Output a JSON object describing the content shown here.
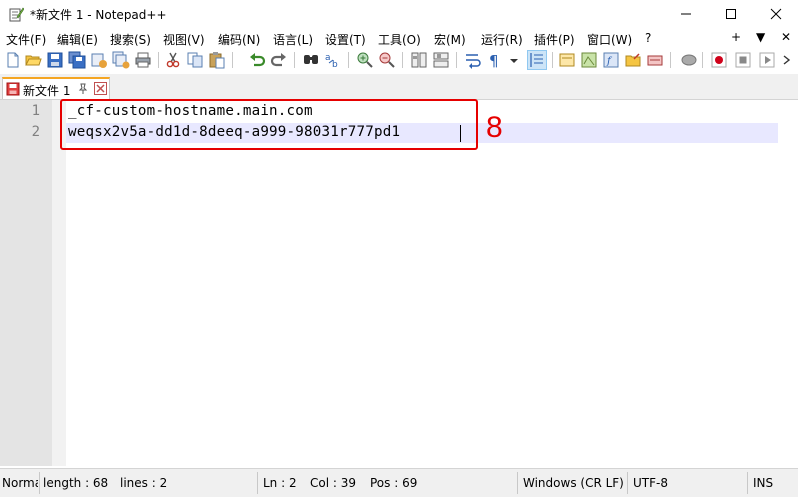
{
  "window": {
    "title": "*新文件 1 - Notepad++"
  },
  "menu": {
    "items": [
      "文件(F)",
      "编辑(E)",
      "搜索(S)",
      "视图(V)",
      "编码(N)",
      "语言(L)",
      "设置(T)",
      "工具(O)",
      "宏(M)",
      "运行(R)",
      "插件(P)",
      "窗口(W)",
      "?"
    ],
    "right": [
      "+",
      "▼",
      "✕"
    ]
  },
  "tab": {
    "label": "新文件 1"
  },
  "editor": {
    "line_numbers": [
      "1",
      "2"
    ],
    "lines": [
      "_cf-custom-hostname.main.com",
      "weqsx2v5a-dd1d-8deeq-a999-98031r777pd1"
    ]
  },
  "annotation": {
    "number": "8",
    "color": "#e60000"
  },
  "status": {
    "mode": "Normal text file",
    "length": "length : 68",
    "lines": "lines : 2",
    "ln": "Ln : 2",
    "col": "Col : 39",
    "pos": "Pos : 69",
    "eol": "Windows (CR LF)",
    "encoding": "UTF-8",
    "ins": "INS"
  },
  "icons": {
    "toolbar": [
      "new-file-icon",
      "open-file-icon",
      "save-icon",
      "save-all-icon",
      "close-icon",
      "close-all-icon",
      "print-icon",
      "cut-icon",
      "copy-icon",
      "paste-icon",
      "undo-icon",
      "redo-icon",
      "find-icon",
      "replace-icon",
      "zoom-in-icon",
      "zoom-out-icon",
      "sync-v-icon",
      "sync-h-icon",
      "word-wrap-icon",
      "show-all-chars-icon",
      "dropdown-icon",
      "indent-guide-icon",
      "lang-icon",
      "doc-map-icon",
      "function-list-icon",
      "folder-workspace-icon",
      "monitoring-icon",
      "macro-record-icon",
      "macro-stop-icon",
      "macro-play-icon"
    ]
  },
  "colors": {
    "accent_tab": "#f5a623",
    "current_line": "#e8e8ff",
    "gutter": "#e4e4e4"
  }
}
